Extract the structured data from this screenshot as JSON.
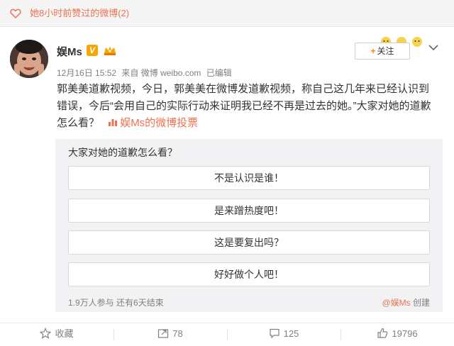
{
  "top_bar": {
    "text": "她8小时前赞过的微博(2)"
  },
  "user": {
    "name": "娱Ms",
    "verified_mark": "V"
  },
  "follow_button": {
    "label": "关注"
  },
  "meta": {
    "date": "12月16日 15:52",
    "source": "来自 微博 weibo.com",
    "edited": "已编辑"
  },
  "post": {
    "line1": "郭美美道歉视频，今日，郭美美在微博发道歉视频，称自己这几年来已经认识到",
    "line2": "错误，今后“会用自己的实际行动来证明我已经不再是过去的她。”大家对她的道歉",
    "line3_text": "怎么看？",
    "vote_link": "娱Ms的微博投票"
  },
  "vote": {
    "question": "大家对她的道歉怎么看？",
    "options": [
      "不是认识是谁！",
      "是来蹭热度吧！",
      "这是要复出吗？",
      "好好做个人吧！"
    ],
    "stats": "1.9万人参与 还有6天结束",
    "creator": "@娱Ms",
    "creator_suffix": "创建"
  },
  "actions": {
    "favorite": "收藏",
    "repost": "78",
    "comment": "125",
    "like": "19796"
  },
  "colors": {
    "accent": "#eb7350",
    "follow_plus": "#ff8200",
    "verified": "#f7a500"
  },
  "icons": [
    "heart-icon",
    "verified-icon",
    "crown-icon",
    "chevron-down-icon",
    "star-icon",
    "repost-icon",
    "comment-icon",
    "like-icon",
    "vote-icon"
  ]
}
